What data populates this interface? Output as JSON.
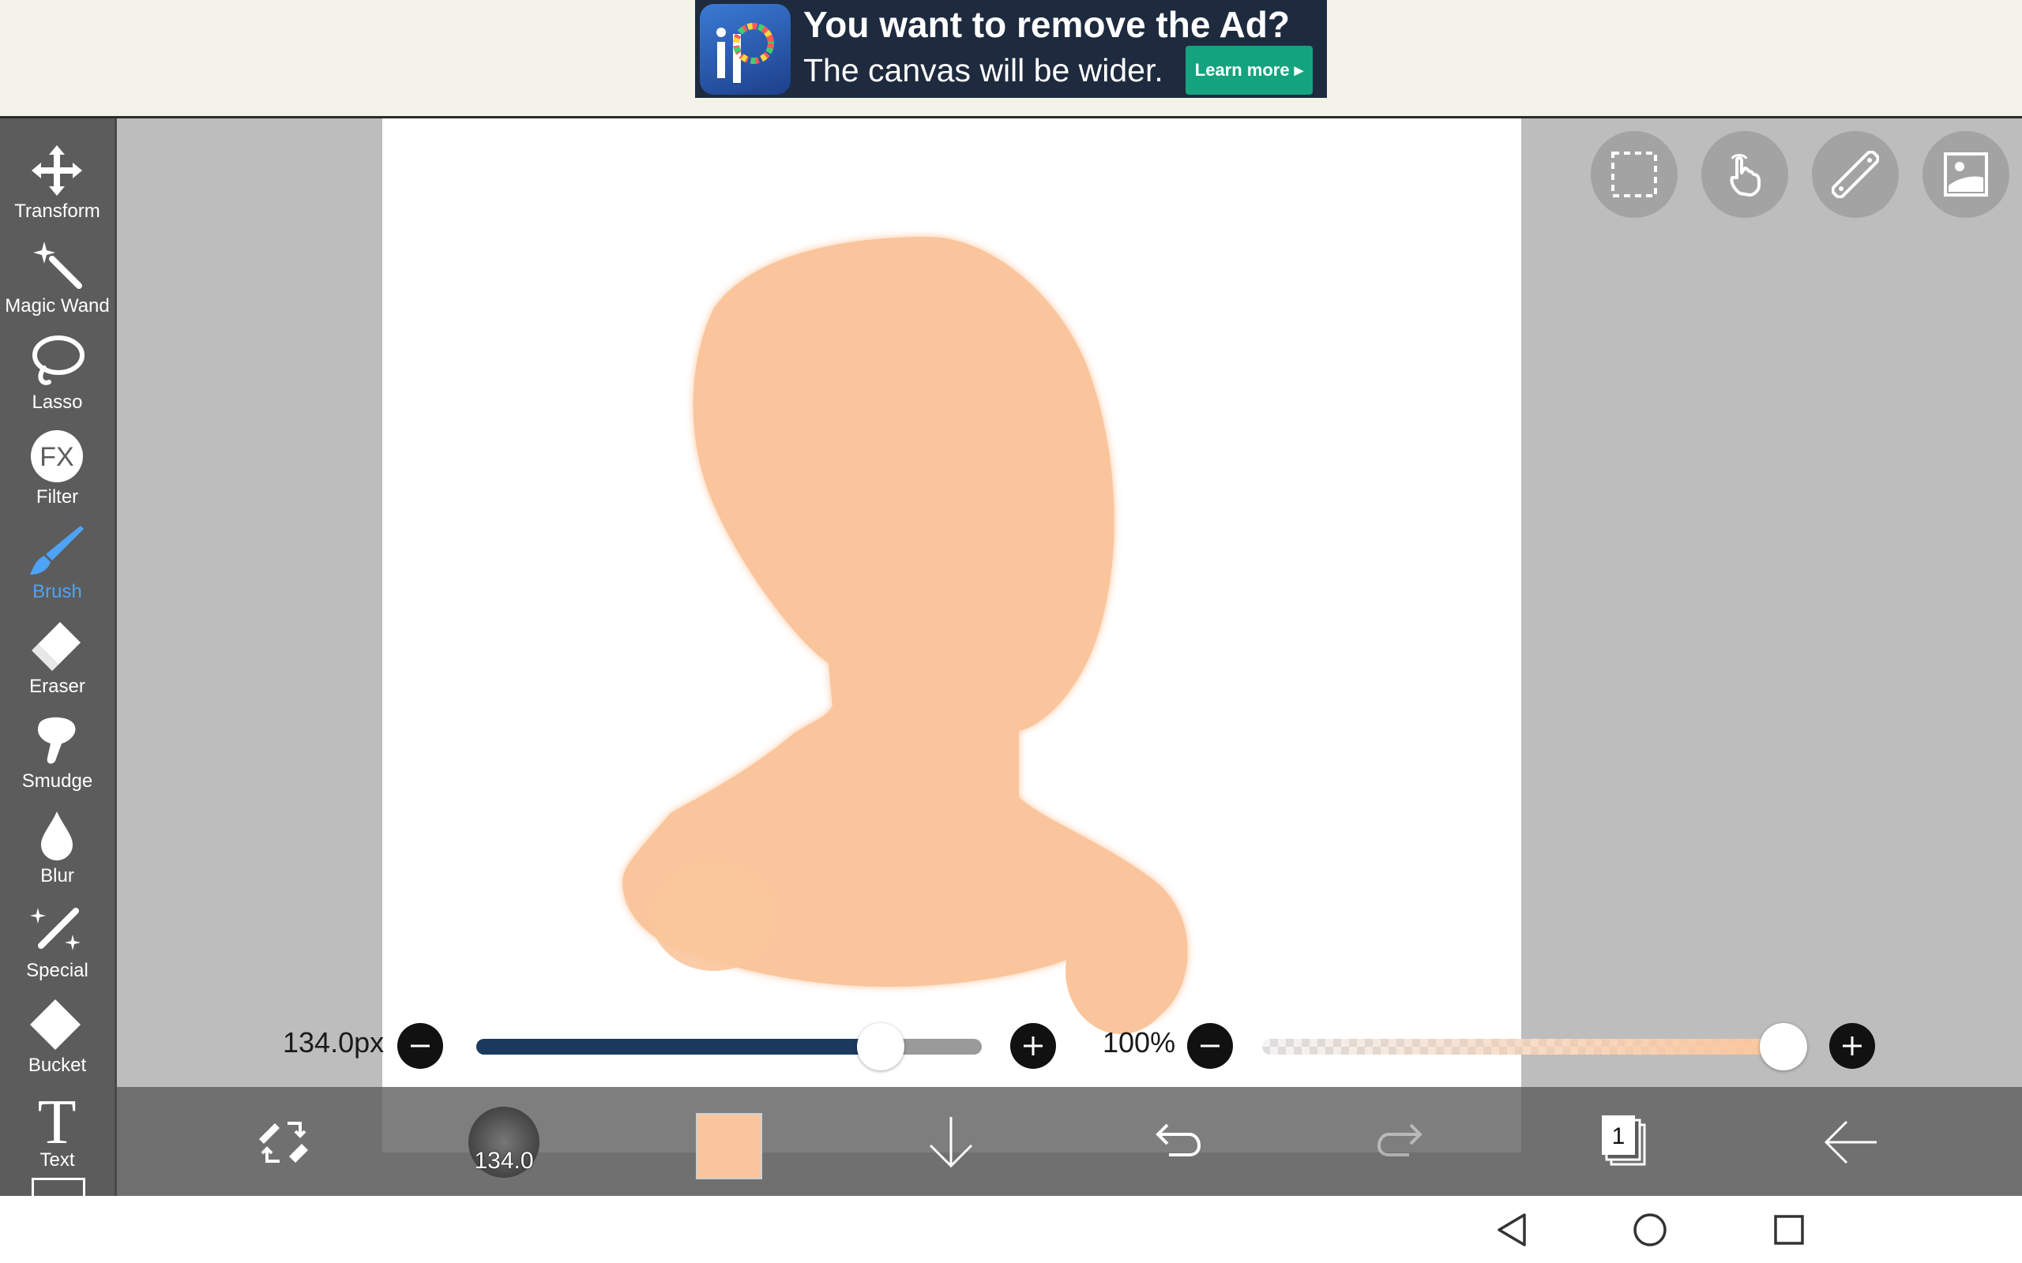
{
  "ad": {
    "title": "You want to remove the Ad?",
    "subtitle": "The canvas will be wider.",
    "cta": "Learn more"
  },
  "tools": [
    {
      "label": "Transform",
      "icon": "move-icon"
    },
    {
      "label": "Magic Wand",
      "icon": "magic-wand-icon"
    },
    {
      "label": "Lasso",
      "icon": "lasso-icon"
    },
    {
      "label": "Filter",
      "icon": "fx-icon",
      "glyph": "FX"
    },
    {
      "label": "Brush",
      "icon": "brush-icon",
      "active": true
    },
    {
      "label": "Eraser",
      "icon": "eraser-icon"
    },
    {
      "label": "Smudge",
      "icon": "smudge-icon"
    },
    {
      "label": "Blur",
      "icon": "droplet-icon"
    },
    {
      "label": "Special",
      "icon": "sparkle-brush-icon"
    },
    {
      "label": "Bucket",
      "icon": "bucket-icon"
    },
    {
      "label": "Text",
      "icon": "text-icon",
      "glyph": "T"
    }
  ],
  "topButtons": [
    "selection-icon",
    "hand-gesture-icon",
    "ruler-icon",
    "image-icon"
  ],
  "brushSize": {
    "label": "134.0px",
    "value": 134.0,
    "fraction": 0.8
  },
  "opacity": {
    "label": "100%",
    "value": 100,
    "fraction": 1.0
  },
  "bottomBar": {
    "brushThumbLabel": "134.0",
    "currentColor": "#fac59c",
    "layerCount": "1"
  },
  "colors": {
    "accent": "#4da3f5",
    "skin": "#fac59c",
    "sliderFill": "#1c3a5e"
  }
}
